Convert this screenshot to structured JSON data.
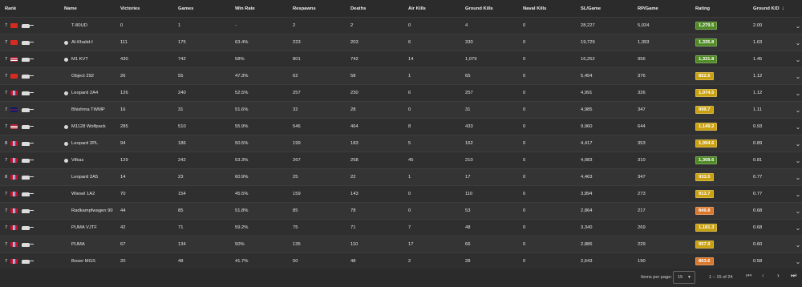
{
  "headers": {
    "rank": "Rank",
    "name": "Name",
    "victories": "Victories",
    "games": "Games",
    "win_rate": "Win Rate",
    "respawns": "Respawns",
    "deaths": "Deaths",
    "air_kills": "Air Kills",
    "ground_kills": "Ground Kills",
    "naval_kills": "Naval Kills",
    "sl_game": "SL/Game",
    "rp_game": "RP/Game",
    "rating": "Rating",
    "ground_kd": "Ground K/D"
  },
  "sort_icon": "arrow-down-icon",
  "colors": {
    "green": "#4f8a24",
    "yellow": "#c9a010",
    "orange": "#d9772b"
  },
  "rows": [
    {
      "rank": "7",
      "flag": "cn",
      "vehicle_icon": false,
      "name": "T-80UD",
      "victories": "0",
      "games": "1",
      "win_rate": "-",
      "respawns": "2",
      "deaths": "2",
      "air_kills": "0",
      "ground_kills": "4",
      "naval_kills": "0",
      "sl_game": "28,227",
      "rp_game": "5,034",
      "rating": "1,279.5",
      "rating_color": "green",
      "kd": "2.00"
    },
    {
      "rank": "7",
      "flag": "cn",
      "vehicle_icon": true,
      "name": "Al-Khalid-I",
      "victories": "111",
      "games": "175",
      "win_rate": "63.4%",
      "respawns": "223",
      "deaths": "203",
      "air_kills": "6",
      "ground_kills": "330",
      "naval_kills": "0",
      "sl_game": "19,729",
      "rp_game": "1,393",
      "rating": "1,335.8",
      "rating_color": "green",
      "kd": "1.63"
    },
    {
      "rank": "7",
      "flag": "us",
      "vehicle_icon": true,
      "name": "M1 KVT",
      "victories": "430",
      "games": "742",
      "win_rate": "58%",
      "respawns": "801",
      "deaths": "742",
      "air_kills": "14",
      "ground_kills": "1,079",
      "naval_kills": "0",
      "sl_game": "16,252",
      "rp_game": "956",
      "rating": "1,331.8",
      "rating_color": "green",
      "kd": "1.45"
    },
    {
      "rank": "7",
      "flag": "cn",
      "vehicle_icon": false,
      "name": "Object 292",
      "victories": "26",
      "games": "55",
      "win_rate": "47.3%",
      "respawns": "62",
      "deaths": "58",
      "air_kills": "1",
      "ground_kills": "65",
      "naval_kills": "0",
      "sl_game": "5,454",
      "rp_game": "376",
      "rating": "852.6",
      "rating_color": "yellow",
      "kd": "1.12"
    },
    {
      "rank": "7",
      "flag": "no",
      "vehicle_icon": true,
      "name": "Leopard 2A4",
      "victories": "126",
      "games": "240",
      "win_rate": "52.5%",
      "respawns": "257",
      "deaths": "230",
      "air_kills": "6",
      "ground_kills": "257",
      "naval_kills": "0",
      "sl_game": "4,991",
      "rp_game": "326",
      "rating": "1,074.5",
      "rating_color": "yellow",
      "kd": "1.12"
    },
    {
      "rank": "7",
      "flag": "uk",
      "vehicle_icon": false,
      "name": "Bhishma TWMP",
      "victories": "16",
      "games": "31",
      "win_rate": "51.6%",
      "respawns": "32",
      "deaths": "28",
      "air_kills": "0",
      "ground_kills": "31",
      "naval_kills": "0",
      "sl_game": "4,985",
      "rp_game": "347",
      "rating": "999.7",
      "rating_color": "yellow",
      "kd": "1.11"
    },
    {
      "rank": "7",
      "flag": "us",
      "vehicle_icon": true,
      "name": "M1128 Wolfpack",
      "victories": "285",
      "games": "510",
      "win_rate": "55.9%",
      "respawns": "546",
      "deaths": "464",
      "air_kills": "8",
      "ground_kills": "433",
      "naval_kills": "0",
      "sl_game": "9,960",
      "rp_game": "644",
      "rating": "1,149.2",
      "rating_color": "yellow",
      "kd": "0.93"
    },
    {
      "rank": "8",
      "flag": "no",
      "vehicle_icon": true,
      "name": "Leopard 2PL",
      "victories": "94",
      "games": "186",
      "win_rate": "50.5%",
      "respawns": "199",
      "deaths": "183",
      "air_kills": "5",
      "ground_kills": "162",
      "naval_kills": "0",
      "sl_game": "4,417",
      "rp_game": "353",
      "rating": "1,094.6",
      "rating_color": "yellow",
      "kd": "0.89"
    },
    {
      "rank": "7",
      "flag": "no",
      "vehicle_icon": true,
      "name": "Vilkas",
      "victories": "129",
      "games": "242",
      "win_rate": "53.3%",
      "respawns": "267",
      "deaths": "258",
      "air_kills": "45",
      "ground_kills": "210",
      "naval_kills": "0",
      "sl_game": "4,083",
      "rp_game": "310",
      "rating": "1,308.6",
      "rating_color": "green",
      "kd": "0.81"
    },
    {
      "rank": "8",
      "flag": "no",
      "vehicle_icon": false,
      "name": "Leopard 2A5",
      "victories": "14",
      "games": "23",
      "win_rate": "60.9%",
      "respawns": "25",
      "deaths": "22",
      "air_kills": "1",
      "ground_kills": "17",
      "naval_kills": "0",
      "sl_game": "4,463",
      "rp_game": "347",
      "rating": "933.5",
      "rating_color": "yellow",
      "kd": "0.77"
    },
    {
      "rank": "7",
      "flag": "no",
      "vehicle_icon": false,
      "name": "Wiesel 1A2",
      "victories": "70",
      "games": "154",
      "win_rate": "45.5%",
      "respawns": "159",
      "deaths": "143",
      "air_kills": "0",
      "ground_kills": "110",
      "naval_kills": "0",
      "sl_game": "3,894",
      "rp_game": "273",
      "rating": "913.7",
      "rating_color": "yellow",
      "kd": "0.77"
    },
    {
      "rank": "7",
      "flag": "no",
      "vehicle_icon": false,
      "name": "Radkampfwagen 90",
      "victories": "44",
      "games": "85",
      "win_rate": "51.8%",
      "respawns": "85",
      "deaths": "78",
      "air_kills": "0",
      "ground_kills": "53",
      "naval_kills": "0",
      "sl_game": "2,864",
      "rp_game": "217",
      "rating": "849.8",
      "rating_color": "orange",
      "kd": "0.68"
    },
    {
      "rank": "7",
      "flag": "no",
      "vehicle_icon": false,
      "name": "PUMA VJTF",
      "victories": "42",
      "games": "71",
      "win_rate": "59.2%",
      "respawns": "75",
      "deaths": "71",
      "air_kills": "7",
      "ground_kills": "48",
      "naval_kills": "0",
      "sl_game": "3,340",
      "rp_game": "269",
      "rating": "1,181.3",
      "rating_color": "yellow",
      "kd": "0.68"
    },
    {
      "rank": "7",
      "flag": "no",
      "vehicle_icon": false,
      "name": "PUMA",
      "victories": "67",
      "games": "134",
      "win_rate": "50%",
      "respawns": "135",
      "deaths": "110",
      "air_kills": "17",
      "ground_kills": "66",
      "naval_kills": "0",
      "sl_game": "2,886",
      "rp_game": "229",
      "rating": "957.9",
      "rating_color": "yellow",
      "kd": "0.60"
    },
    {
      "rank": "7",
      "flag": "no",
      "vehicle_icon": false,
      "name": "Boxer MGS",
      "victories": "20",
      "games": "48",
      "win_rate": "41.7%",
      "respawns": "50",
      "deaths": "48",
      "air_kills": "2",
      "ground_kills": "28",
      "naval_kills": "0",
      "sl_game": "2,643",
      "rp_game": "190",
      "rating": "863.6",
      "rating_color": "orange",
      "kd": "0.58"
    }
  ],
  "footer": {
    "items_per_page_label": "Items per page:",
    "items_per_page": "15",
    "range": "1 – 15 of 24",
    "first_icon": "first-page-icon",
    "prev_icon": "chevron-left-icon",
    "next_icon": "chevron-right-icon",
    "last_icon": "last-page-icon"
  }
}
